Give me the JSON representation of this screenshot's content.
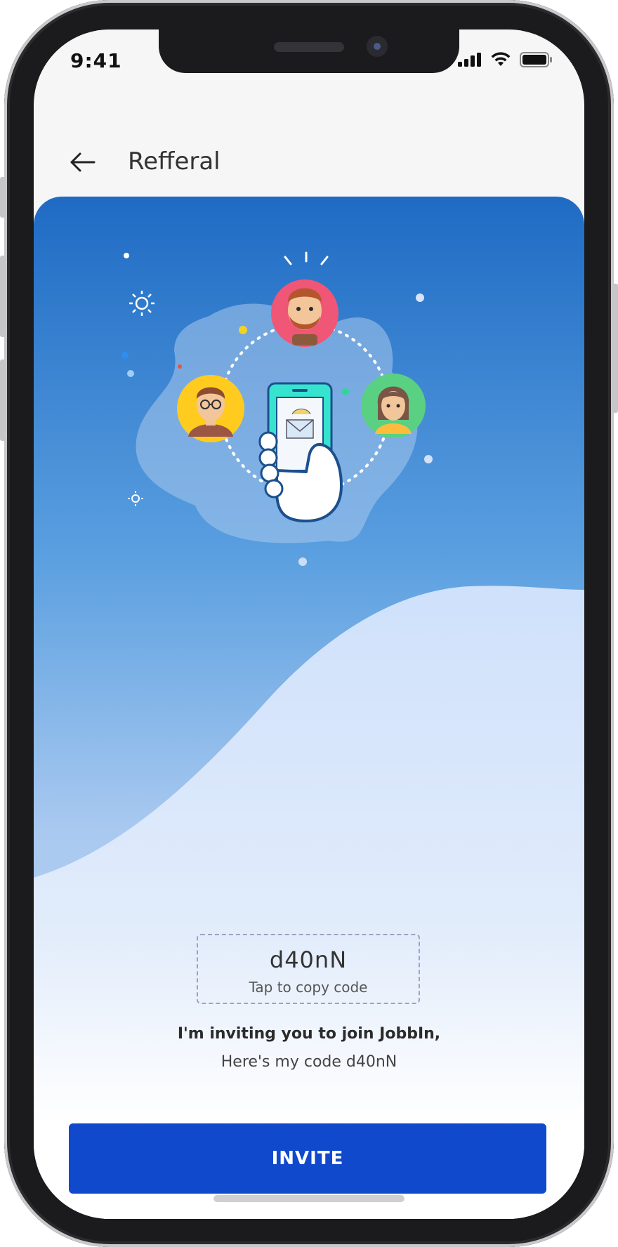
{
  "status_bar": {
    "time": "9:41",
    "icons": [
      "cellular-signal-icon",
      "wifi-icon",
      "battery-icon"
    ]
  },
  "header": {
    "back_icon": "arrow-left-icon",
    "title": "Refferal"
  },
  "referral": {
    "code": "d40nN",
    "copy_hint": "Tap to copy code",
    "message_line1": "I'm inviting you to join JobbIn,",
    "message_line2": "Here's my code d40nN"
  },
  "actions": {
    "invite_label": "INVITE"
  },
  "colors": {
    "primary": "#1049cc",
    "hero_top": "#1f6bc4",
    "hero_mid": "#5a9fe0",
    "wave_light": "#d3e4fb",
    "avatar_red": "#f05676",
    "avatar_yellow": "#ffcb1f",
    "avatar_green": "#5ad083",
    "phone_teal": "#36e3cf"
  }
}
